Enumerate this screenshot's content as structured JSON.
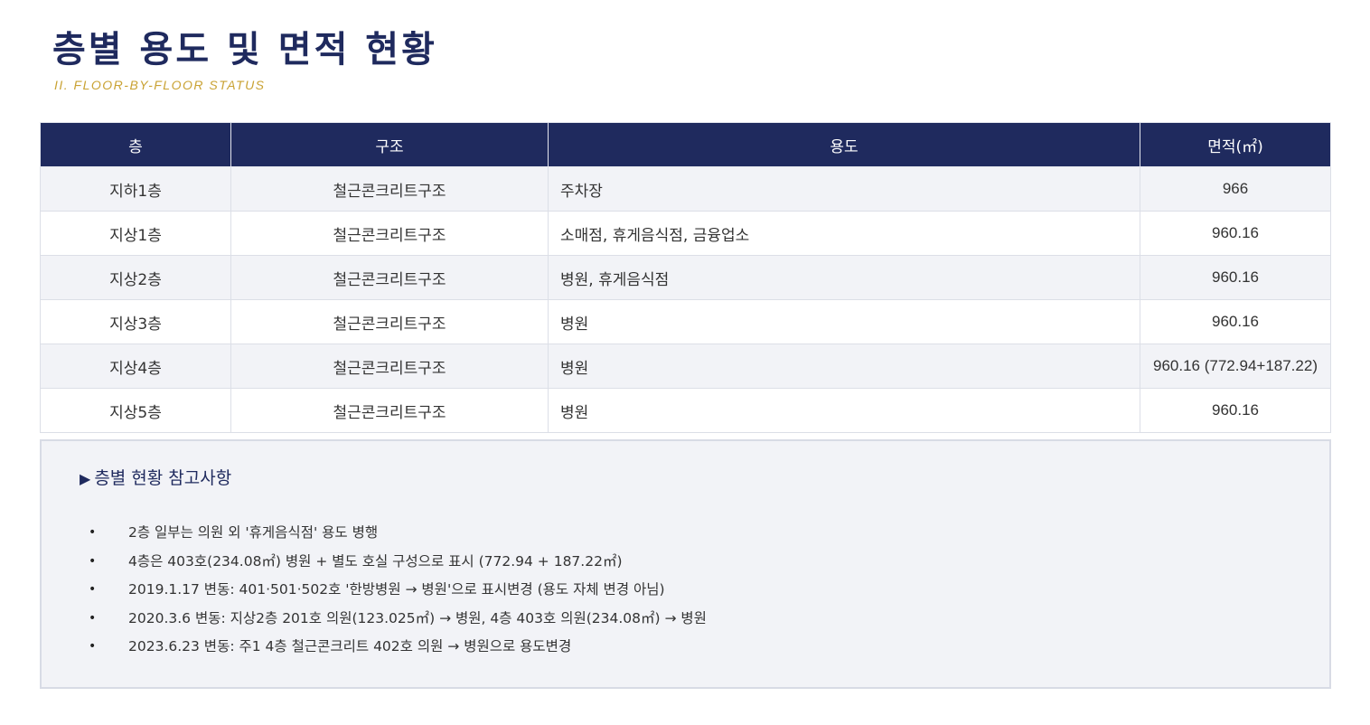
{
  "page": {
    "title": "층별 용도 및 면적 현황",
    "subtitle": "II. FLOOR-BY-FLOOR STATUS"
  },
  "table": {
    "headers": {
      "floor": "층",
      "structure": "구조",
      "use": "용도",
      "area": "면적(㎡)"
    },
    "rows": [
      {
        "floor": "지하1층",
        "structure": "철근콘크리트구조",
        "use": "주차장",
        "area": "966"
      },
      {
        "floor": "지상1층",
        "structure": "철근콘크리트구조",
        "use": "소매점, 휴게음식점, 금융업소",
        "area": "960.16"
      },
      {
        "floor": "지상2층",
        "structure": "철근콘크리트구조",
        "use": "병원, 휴게음식점",
        "area": "960.16"
      },
      {
        "floor": "지상3층",
        "structure": "철근콘크리트구조",
        "use": "병원",
        "area": "960.16"
      },
      {
        "floor": "지상4층",
        "structure": "철근콘크리트구조",
        "use": "병원",
        "area": "960.16 (772.94+187.22)"
      },
      {
        "floor": "지상5층",
        "structure": "철근콘크리트구조",
        "use": "병원",
        "area": "960.16"
      }
    ]
  },
  "notes": {
    "marker": "▶",
    "heading": "층별 현황 참고사항",
    "bullet": "•",
    "items": [
      "2층 일부는 의원 외 '휴게음식점' 용도 병행",
      "4층은 403호(234.08㎡) 병원 + 별도 호실 구성으로 표시 (772.94 + 187.22㎡)",
      "2019.1.17 변동: 401·501·502호 '한방병원 → 병원'으로 표시변경 (용도 자체 변경 아님)",
      "2020.3.6 변동: 지상2층 201호 의원(123.025㎡) → 병원, 4층 403호 의원(234.08㎡) → 병원",
      "2023.6.23 변동: 주1 4층 철근콘크리트 402호 의원 → 병원으로 용도변경"
    ]
  },
  "colors": {
    "navy": "#1f2a5e",
    "gold": "#c9a233",
    "row_alt": "#f2f3f7"
  }
}
